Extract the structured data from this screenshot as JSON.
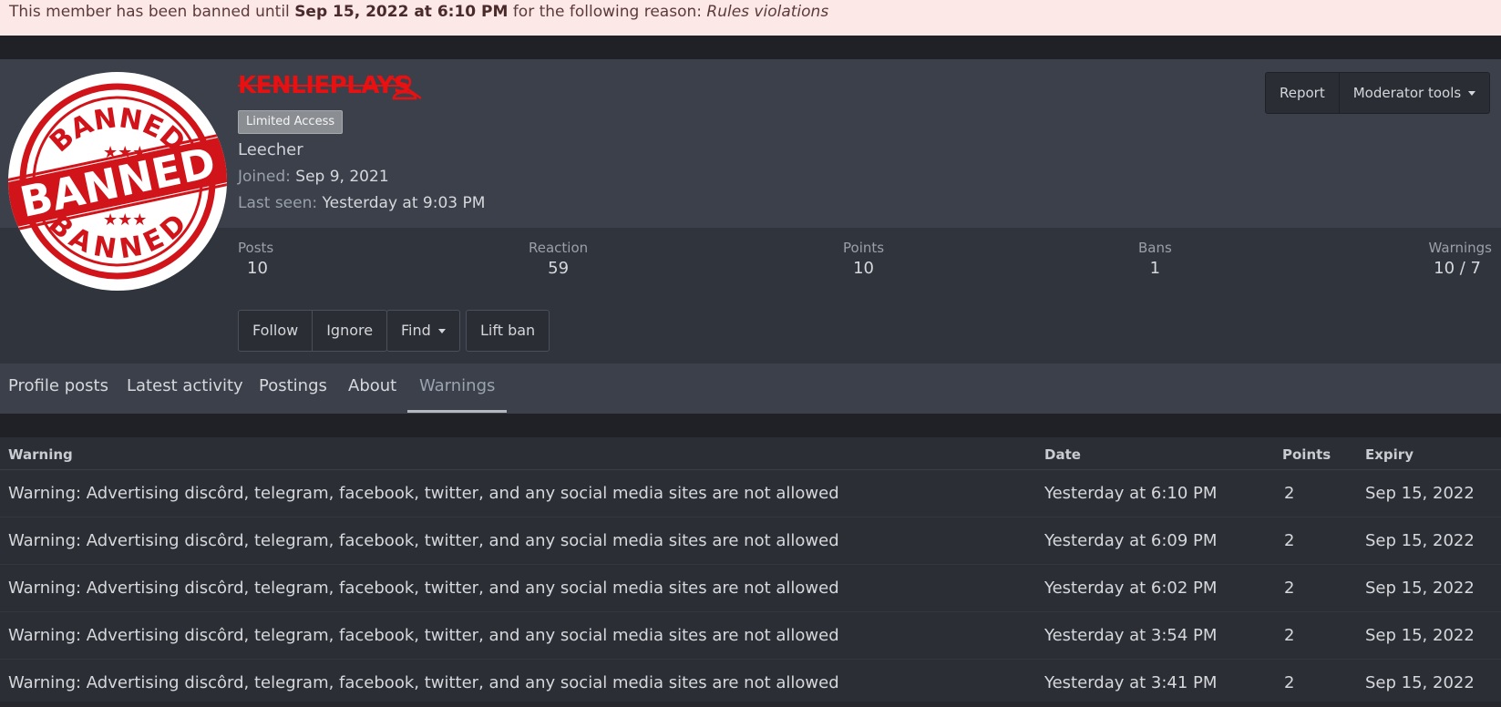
{
  "ban_notice": {
    "prefix": "This member has been banned until ",
    "until": "Sep 15, 2022 at 6:10 PM",
    "middle": " for the following reason: ",
    "reason": "Rules violations"
  },
  "avatar": {
    "stamp_top": "BANNED",
    "stamp_center": "BANNED",
    "stamp_bottom": "BANNED"
  },
  "profile": {
    "username": "KENLIEPLAYS",
    "badge": "Limited Access",
    "user_title": "Leecher",
    "joined_label": "Joined:",
    "joined_value": "Sep 9, 2021",
    "last_seen_label": "Last seen:",
    "last_seen_value": "Yesterday at 9:03 PM"
  },
  "header_actions": {
    "report": "Report",
    "moderator_tools": "Moderator tools"
  },
  "stats": [
    {
      "label": "Posts",
      "value": "10"
    },
    {
      "label": "Reaction",
      "value": "59"
    },
    {
      "label": "Points",
      "value": "10"
    },
    {
      "label": "Bans",
      "value": "1"
    },
    {
      "label": "Warnings",
      "value": "10 / 7"
    }
  ],
  "member_buttons": {
    "follow": "Follow",
    "ignore": "Ignore",
    "find": "Find",
    "lift_ban": "Lift ban"
  },
  "tabs": [
    {
      "label": "Profile posts"
    },
    {
      "label": "Latest activity"
    },
    {
      "label": "Postings"
    },
    {
      "label": "About"
    },
    {
      "label": "Warnings"
    }
  ],
  "active_tab": "Warnings",
  "warnings_table": {
    "headers": {
      "warning": "Warning",
      "date": "Date",
      "points": "Points",
      "expiry": "Expiry"
    },
    "rows": [
      {
        "warning": "Warning: Advertising discôrd, telegram, facebook, twitter, and any social media sites are not allowed",
        "date": "Yesterday at 6:10 PM",
        "points": "2",
        "expiry": "Sep 15, 2022"
      },
      {
        "warning": "Warning: Advertising discôrd, telegram, facebook, twitter, and any social media sites are not allowed",
        "date": "Yesterday at 6:09 PM",
        "points": "2",
        "expiry": "Sep 15, 2022"
      },
      {
        "warning": "Warning: Advertising discôrd, telegram, facebook, twitter, and any social media sites are not allowed",
        "date": "Yesterday at 6:02 PM",
        "points": "2",
        "expiry": "Sep 15, 2022"
      },
      {
        "warning": "Warning: Advertising discôrd, telegram, facebook, twitter, and any social media sites are not allowed",
        "date": "Yesterday at 3:54 PM",
        "points": "2",
        "expiry": "Sep 15, 2022"
      },
      {
        "warning": "Warning: Advertising discôrd, telegram, facebook, twitter, and any social media sites are not allowed",
        "date": "Yesterday at 3:41 PM",
        "points": "2",
        "expiry": "Sep 15, 2022"
      }
    ]
  },
  "colors": {
    "username": "#e81010",
    "stamp": "#d0141a",
    "notice_bg": "#fde8e8"
  },
  "icons": {
    "banned_user": "user-slash-icon",
    "dropdown": "caret-down-icon"
  }
}
